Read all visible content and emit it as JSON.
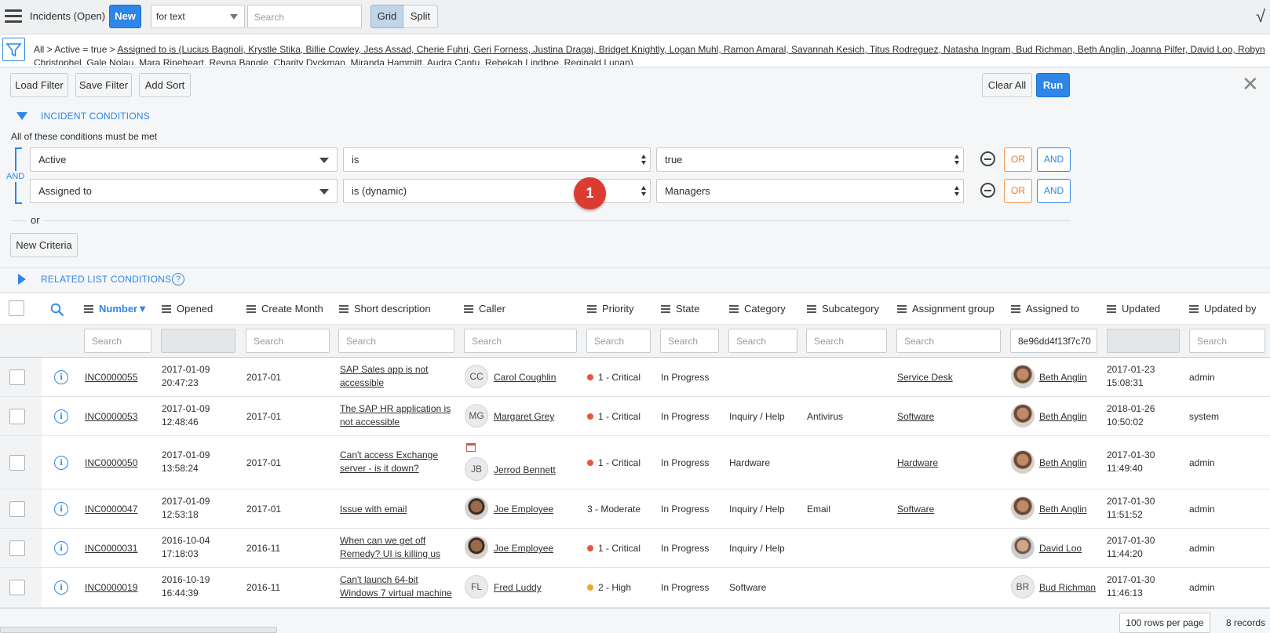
{
  "header": {
    "title": "Incidents (Open)",
    "new_label": "New",
    "search_field_select": "for text",
    "search_placeholder": "Search",
    "grid_label": "Grid",
    "split_label": "Split"
  },
  "breadcrumb": {
    "all": "All",
    "sep": ">",
    "active": "Active = true",
    "assigned": "Assigned to is (Lucius Bagnoli, Krystle Stika, Billie Cowley, Jess Assad, Cherie Fuhri, Geri Forness, Justina Dragaj, Bridget Knightly, Logan Muhl, Ramon Amaral, Savannah Kesich, Titus Rodreguez, Natasha Ingram, Bud Richman, Beth Anglin, Joanna Pilfer, David Loo, Robyn Christophel, Gale Nolau, Mara Rineheart, Reyna Bangle, Charity Dyckman, Miranda Hammitt, Audra Cantu, Rebekah Lindboe, Reginald Lunan)"
  },
  "filter": {
    "load_filter": "Load Filter",
    "save_filter": "Save Filter",
    "add_sort": "Add Sort",
    "clear_all": "Clear All",
    "run": "Run",
    "incident_conditions": "INCIDENT CONDITIONS",
    "all_met": "All of these conditions must be met",
    "and_label": "AND",
    "conditions": [
      {
        "field": "Active",
        "operator": "is",
        "value": "true",
        "or": "OR",
        "and": "AND"
      },
      {
        "field": "Assigned to",
        "operator": "is (dynamic)",
        "value": "Managers",
        "or": "OR",
        "and": "AND"
      }
    ],
    "badge": "1",
    "or_label": "or",
    "new_criteria": "New Criteria",
    "related_list": "RELATED LIST CONDITIONS",
    "help": "?"
  },
  "table": {
    "columns": [
      "Number",
      "Opened",
      "Create Month",
      "Short description",
      "Caller",
      "Priority",
      "State",
      "Category",
      "Subcategory",
      "Assignment group",
      "Assigned to",
      "Updated",
      "Updated by"
    ],
    "sort_indicator": "▼",
    "search_placeholder": "Search",
    "assigned_to_filter_value": "8e96dd4f13f7c70",
    "rows": [
      {
        "number": "INC0000055",
        "opened_date": "2017-01-09",
        "opened_time": "20:47:23",
        "create_month": "2017-01",
        "desc1": "SAP Sales app is not",
        "desc2": "accessible",
        "caller_initials": "CC",
        "caller": "Carol Coughlin",
        "priority": "1 - Critical",
        "priority_color": "#e8553f",
        "state": "In Progress",
        "category": "",
        "subcategory": "",
        "group": "Service Desk",
        "assigned": "Beth Anglin",
        "updated_date": "2017-01-23",
        "updated_time": "15:08:31",
        "updated_by": "admin"
      },
      {
        "number": "INC0000053",
        "opened_date": "2017-01-09",
        "opened_time": "12:48:46",
        "create_month": "2017-01",
        "desc1": "The SAP HR application is",
        "desc2": "not accessible",
        "caller_initials": "MG",
        "caller": "Margaret Grey",
        "priority": "1 - Critical",
        "priority_color": "#e8553f",
        "state": "In Progress",
        "category": "Inquiry / Help",
        "subcategory": "Antivirus",
        "group": "Software",
        "assigned": "Beth Anglin",
        "updated_date": "2018-01-26",
        "updated_time": "10:50:02",
        "updated_by": "system"
      },
      {
        "number": "INC0000050",
        "opened_date": "2017-01-09",
        "opened_time": "13:58:24",
        "create_month": "2017-01",
        "desc1": "Can't access Exchange",
        "desc2": "server - is it down?",
        "caller_initials": "JB",
        "caller": "Jerrod Bennett",
        "priority": "1 - Critical",
        "priority_color": "#e8553f",
        "state": "In Progress",
        "category": "Hardware",
        "subcategory": "",
        "group": "Hardware",
        "assigned": "Beth Anglin",
        "updated_date": "2017-01-30",
        "updated_time": "11:49:40",
        "updated_by": "admin"
      },
      {
        "number": "INC0000047",
        "opened_date": "2017-01-09",
        "opened_time": "12:53:18",
        "create_month": "2017-01",
        "desc1": "Issue with email",
        "desc2": "",
        "caller_initials": "",
        "caller": "Joe Employee",
        "priority": "3 - Moderate",
        "priority_color": "",
        "state": "In Progress",
        "category": "Inquiry / Help",
        "subcategory": "Email",
        "group": "Software",
        "assigned": "Beth Anglin",
        "updated_date": "2017-01-30",
        "updated_time": "11:51:52",
        "updated_by": "admin"
      },
      {
        "number": "INC0000031",
        "opened_date": "2016-10-04",
        "opened_time": "17:18:03",
        "create_month": "2016-11",
        "desc1": "When can we get off",
        "desc2": "Remedy? UI is killing us",
        "caller_initials": "",
        "caller": "Joe Employee",
        "priority": "1 - Critical",
        "priority_color": "#e8553f",
        "state": "In Progress",
        "category": "Inquiry / Help",
        "subcategory": "",
        "group": "",
        "assigned": "David Loo",
        "updated_date": "2017-01-30",
        "updated_time": "11:44:20",
        "updated_by": "admin"
      },
      {
        "number": "INC0000019",
        "opened_date": "2016-10-19",
        "opened_time": "16:44:39",
        "create_month": "2016-11",
        "desc1": "Can't launch 64-bit",
        "desc2": "Windows 7 virtual machine",
        "caller_initials": "FL",
        "caller": "Fred Luddy",
        "priority": "2 - High",
        "priority_color": "#f5a623",
        "state": "In Progress",
        "category": "Software",
        "subcategory": "",
        "group": "",
        "assigned": "Bud Richman",
        "assigned_initials": "BR",
        "updated_date": "2017-01-30",
        "updated_time": "11:46:13",
        "updated_by": "admin"
      }
    ]
  },
  "footer": {
    "rows_per_page": "100 rows per page",
    "records": "8 records"
  }
}
